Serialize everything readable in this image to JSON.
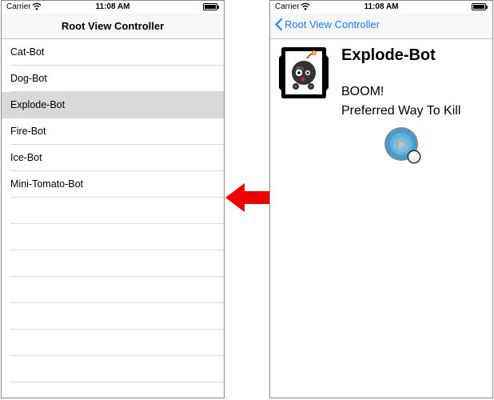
{
  "status_bar": {
    "carrier": "Carrier",
    "time": "11:08 AM"
  },
  "left_screen": {
    "nav_title": "Root View Controller",
    "items": [
      {
        "label": "Cat-Bot"
      },
      {
        "label": "Dog-Bot"
      },
      {
        "label": "Explode-Bot",
        "selected": true
      },
      {
        "label": "Fire-Bot"
      },
      {
        "label": "Ice-Bot"
      },
      {
        "label": "Mini-Tomato-Bot"
      }
    ]
  },
  "right_screen": {
    "back_label": "Root View Controller",
    "name": "Explode-Bot",
    "quote": "BOOM!",
    "kill_method": "Preferred Way To Kill"
  },
  "colors": {
    "accent": "#1a7cf5",
    "selection": "#d9d9d9",
    "arrow": "#ee0000",
    "navbar": "#f7f7f7"
  },
  "icons": [
    "wifi-icon",
    "battery-icon",
    "back-chevron-icon",
    "bomb-bot-icon",
    "play-icon",
    "left-arrow-icon"
  ]
}
